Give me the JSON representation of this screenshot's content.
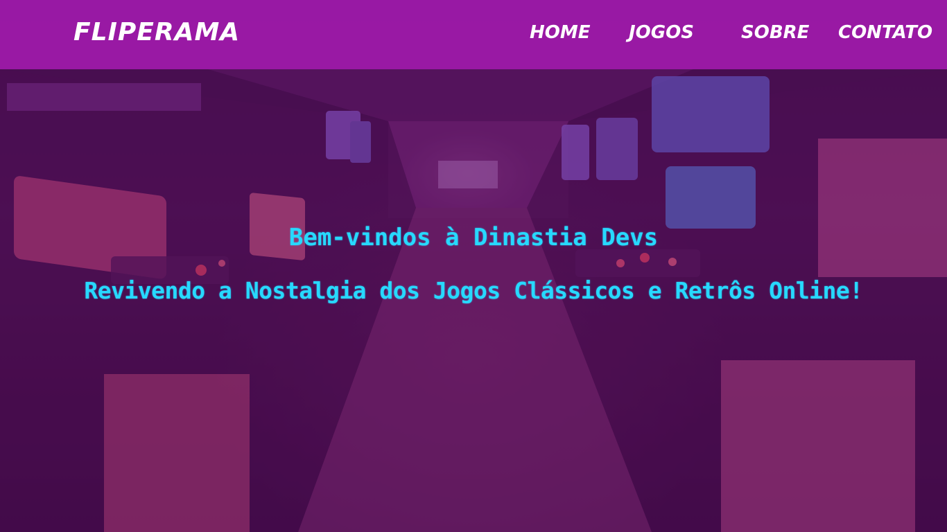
{
  "header": {
    "logo": "FLIPERAMA",
    "nav": {
      "home": "HOME",
      "jogos": "JOGOS",
      "sobre": "SOBRE",
      "contato": "CONTATO"
    }
  },
  "hero": {
    "title": "Bem-vindos à Dinastia Devs",
    "subtitle": "Revivendo a Nostalgia dos Jogos Clássicos e Retrôs Online!"
  },
  "colors": {
    "header_bg": "#a01aaa",
    "hero_text": "#27d9ff",
    "nav_text": "#ffffff",
    "background": "#4a0d4e"
  }
}
